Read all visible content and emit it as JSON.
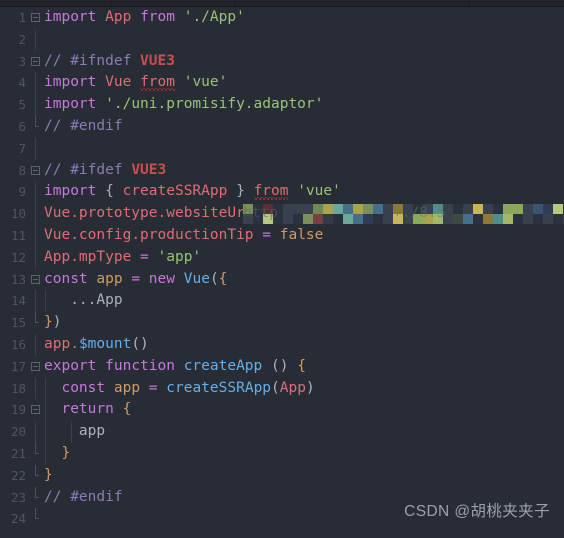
{
  "window": {
    "background": "#282c34",
    "tabstrip_background": "#21252b",
    "tab_separator_positions": [
      110,
      235,
      468
    ]
  },
  "editor": {
    "language": "JavaScript",
    "theme": "One Dark",
    "font_size": 14.5,
    "line_height": 21.8,
    "gutter_color": "#4e5564",
    "total_lines": 24,
    "lines": [
      {
        "number": "1",
        "fold": "box",
        "text": "import App from './App'"
      },
      {
        "number": "2",
        "fold": "none",
        "text": ""
      },
      {
        "number": "3",
        "fold": "box",
        "text": "// #ifndef VUE3"
      },
      {
        "number": "4",
        "fold": "line",
        "text": "  import Vue from 'vue'"
      },
      {
        "number": "5",
        "fold": "line",
        "text": "  import './uni.promisify.adaptor'"
      },
      {
        "number": "6",
        "fold": "end",
        "text": "  // #endif"
      },
      {
        "number": "7",
        "fold": "none",
        "text": ""
      },
      {
        "number": "8",
        "fold": "box",
        "text": "// #ifdef VUE3"
      },
      {
        "number": "9",
        "fold": "line",
        "text": "  import { createSSRApp } from 'vue'"
      },
      {
        "number": "10",
        "fold": "line",
        "text": "  Vue.prototype.websiteUrl =  http",
        "censored": true
      },
      {
        "number": "11",
        "fold": "line",
        "text": "  Vue.config.productionTip = false"
      },
      {
        "number": "12",
        "fold": "line",
        "text": "  App.mpType = 'app'"
      },
      {
        "number": "13",
        "fold": "box",
        "text": "const app = new Vue({"
      },
      {
        "number": "14",
        "fold": "line",
        "text": "    ...App"
      },
      {
        "number": "15",
        "fold": "end",
        "text": "})"
      },
      {
        "number": "16",
        "fold": "line",
        "text": "app.$mount()"
      },
      {
        "number": "17",
        "fold": "box",
        "text": "export function createApp () {"
      },
      {
        "number": "18",
        "fold": "line",
        "text": "    const app = createSSRApp(App)"
      },
      {
        "number": "19",
        "fold": "box",
        "text": "    return {"
      },
      {
        "number": "20",
        "fold": "line",
        "text": "      app"
      },
      {
        "number": "21",
        "fold": "end",
        "text": "    }"
      },
      {
        "number": "22",
        "fold": "end",
        "text": "}"
      },
      {
        "number": "23",
        "fold": "end",
        "text": "// #endif"
      },
      {
        "number": "24",
        "fold": "end",
        "text": ""
      }
    ],
    "diagnostics": [
      {
        "line": "4",
        "token": "from",
        "kind": "spelling-squiggle"
      },
      {
        "line": "9",
        "token": "from",
        "kind": "spelling-squiggle"
      }
    ],
    "censored_line": {
      "line": "10",
      "reason": "pixelated-mosaic",
      "visible_prefix": "http",
      "visible_fragment": "+./8.5",
      "block_size": 10
    },
    "syntax_colors": {
      "keyword": "#c678dd",
      "class": "#e06c75",
      "string": "#98c379",
      "comment": "#8b7bb8",
      "comment_bold": "#c94f4f",
      "function": "#61afef",
      "variable": "#d19a66",
      "punctuation": "#abb2bf",
      "plain": "#abb2bf",
      "squiggle": "#e53935"
    }
  },
  "watermark": {
    "text": "CSDN @胡桃夹夹子",
    "color": "#9aa1ad"
  }
}
